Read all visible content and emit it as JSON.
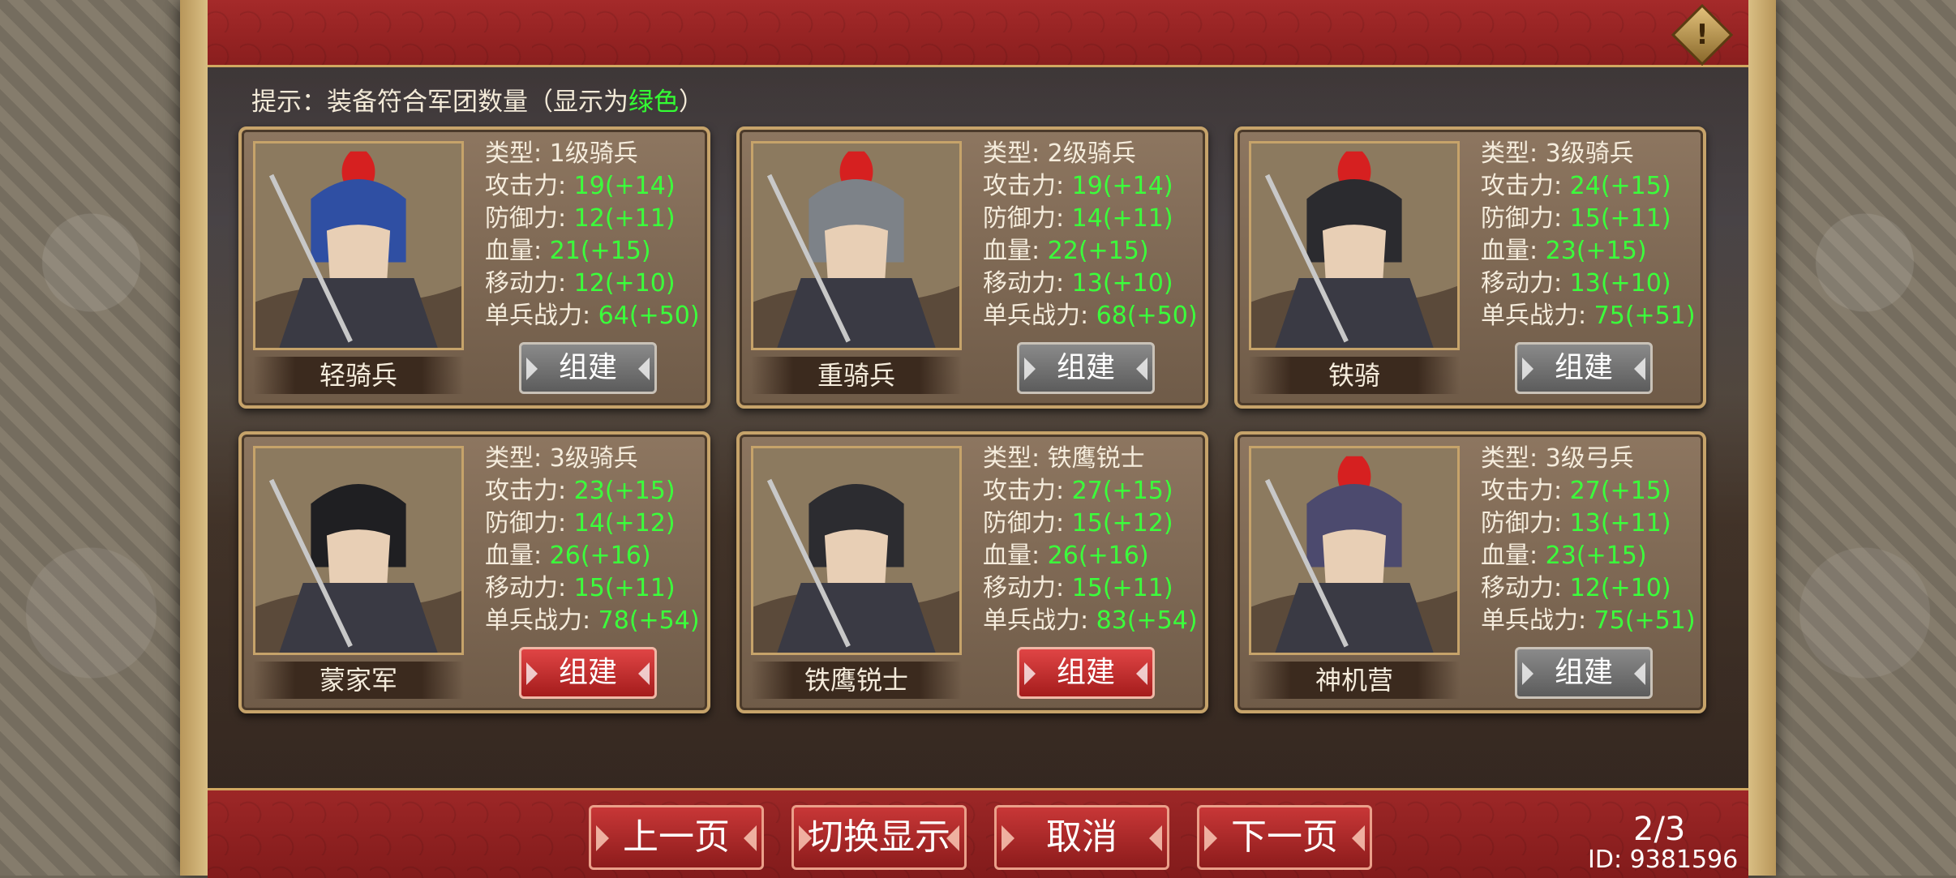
{
  "hint": {
    "prefix": "提示：装备符合军团数量（显示为",
    "green_word": "绿色",
    "suffix": "）"
  },
  "labels": {
    "type": "类型:",
    "attack": "攻击力:",
    "defense": "防御力:",
    "hp": "血量:",
    "move": "移动力:",
    "power": "单兵战力:"
  },
  "units": [
    {
      "name": "轻骑兵",
      "type": "1级骑兵",
      "attack": "19(+14)",
      "defense": "12(+11)",
      "hp": "21(+15)",
      "move": "12(+10)",
      "power": "64(+50)",
      "button": "组建",
      "button_state": "grey",
      "helmet_color": "#2f4fa3",
      "plume": true
    },
    {
      "name": "重骑兵",
      "type": "2级骑兵",
      "attack": "19(+14)",
      "defense": "14(+11)",
      "hp": "22(+15)",
      "move": "13(+10)",
      "power": "68(+50)",
      "button": "组建",
      "button_state": "grey",
      "helmet_color": "#7d8288",
      "plume": true
    },
    {
      "name": "铁骑",
      "type": "3级骑兵",
      "attack": "24(+15)",
      "defense": "15(+11)",
      "hp": "23(+15)",
      "move": "13(+10)",
      "power": "75(+51)",
      "button": "组建",
      "button_state": "grey",
      "helmet_color": "#2b2b2f",
      "plume": true
    },
    {
      "name": "蒙家军",
      "type": "3级骑兵",
      "attack": "23(+15)",
      "defense": "14(+12)",
      "hp": "26(+16)",
      "move": "15(+11)",
      "power": "78(+54)",
      "button": "组建",
      "button_state": "red",
      "helmet_color": "#1f1f22",
      "plume": false
    },
    {
      "name": "铁鹰锐士",
      "type": "铁鹰锐士",
      "attack": "27(+15)",
      "defense": "15(+12)",
      "hp": "26(+16)",
      "move": "15(+11)",
      "power": "83(+54)",
      "button": "组建",
      "button_state": "red",
      "helmet_color": "#2c2c30",
      "plume": false
    },
    {
      "name": "神机营",
      "type": "3级弓兵",
      "attack": "27(+15)",
      "defense": "13(+11)",
      "hp": "23(+15)",
      "move": "12(+10)",
      "power": "75(+51)",
      "button": "组建",
      "button_state": "grey",
      "helmet_color": "#4c4a6e",
      "plume": true
    }
  ],
  "nav": {
    "prev": "上一页",
    "toggle": "切换显示",
    "cancel": "取消",
    "next": "下一页"
  },
  "page_indicator": "2/3",
  "user_id": "ID: 9381596",
  "alert_icon": "!"
}
